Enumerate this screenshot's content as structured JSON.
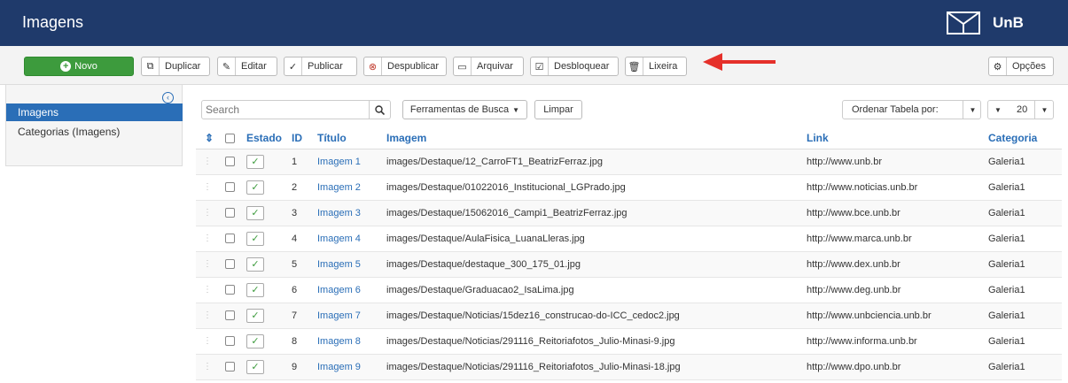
{
  "header": {
    "title": "Imagens",
    "logo_text": "UnB"
  },
  "toolbar": {
    "new_label": "Novo",
    "duplicate_label": "Duplicar",
    "edit_label": "Editar",
    "publish_label": "Publicar",
    "unpublish_label": "Despublicar",
    "archive_label": "Arquivar",
    "unlock_label": "Desbloquear",
    "trash_label": "Lixeira",
    "options_label": "Opções"
  },
  "sidebar": {
    "items": [
      {
        "label": "Imagens"
      },
      {
        "label": "Categorias (Imagens)"
      }
    ]
  },
  "filters": {
    "search_placeholder": "Search",
    "tools_label": "Ferramentas de Busca",
    "clear_label": "Limpar",
    "order_label": "Ordenar Tabela por:",
    "limit_value": "20"
  },
  "table": {
    "headers": {
      "estado": "Estado",
      "id": "ID",
      "titulo": "Título",
      "imagem": "Imagem",
      "link": "Link",
      "categoria": "Categoria"
    },
    "rows": [
      {
        "id": "1",
        "title": "Imagem 1",
        "image": "images/Destaque/12_CarroFT1_BeatrizFerraz.jpg",
        "link": "http://www.unb.br",
        "category": "Galeria1"
      },
      {
        "id": "2",
        "title": "Imagem 2",
        "image": "images/Destaque/01022016_Institucional_LGPrado.jpg",
        "link": "http://www.noticias.unb.br",
        "category": "Galeria1"
      },
      {
        "id": "3",
        "title": "Imagem 3",
        "image": "images/Destaque/15062016_Campi1_BeatrizFerraz.jpg",
        "link": "http://www.bce.unb.br",
        "category": "Galeria1"
      },
      {
        "id": "4",
        "title": "Imagem 4",
        "image": "images/Destaque/AulaFisica_LuanaLleras.jpg",
        "link": "http://www.marca.unb.br",
        "category": "Galeria1"
      },
      {
        "id": "5",
        "title": "Imagem 5",
        "image": "images/Destaque/destaque_300_175_01.jpg",
        "link": "http://www.dex.unb.br",
        "category": "Galeria1"
      },
      {
        "id": "6",
        "title": "Imagem 6",
        "image": "images/Destaque/Graduacao2_IsaLima.jpg",
        "link": "http://www.deg.unb.br",
        "category": "Galeria1"
      },
      {
        "id": "7",
        "title": "Imagem 7",
        "image": "images/Destaque/Noticias/15dez16_construcao-do-ICC_cedoc2.jpg",
        "link": "http://www.unbciencia.unb.br",
        "category": "Galeria1"
      },
      {
        "id": "8",
        "title": "Imagem 8",
        "image": "images/Destaque/Noticias/291116_Reitoriafotos_Julio-Minasi-9.jpg",
        "link": "http://www.informa.unb.br",
        "category": "Galeria1"
      },
      {
        "id": "9",
        "title": "Imagem 9",
        "image": "images/Destaque/Noticias/291116_Reitoriafotos_Julio-Minasi-18.jpg",
        "link": "http://www.dpo.unb.br",
        "category": "Galeria1"
      }
    ]
  },
  "colors": {
    "header_bg": "#1f3a6b",
    "accent": "#2a6eb7",
    "new_button": "#3d9b3d",
    "annotation_arrow": "#e5302a"
  }
}
